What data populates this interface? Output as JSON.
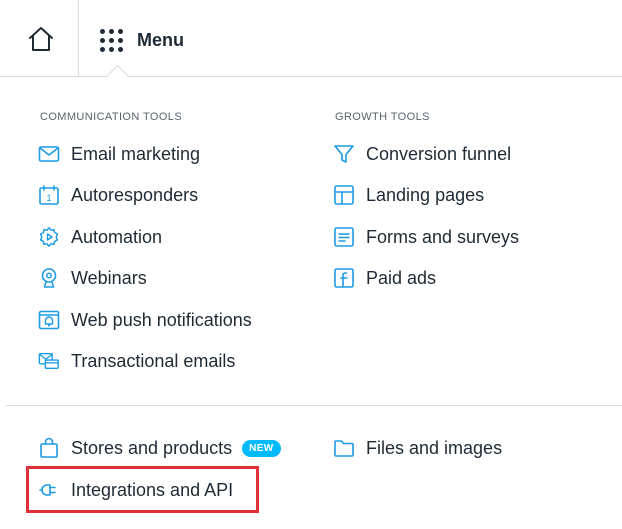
{
  "header": {
    "menu_label": "Menu"
  },
  "communication_tools": {
    "title": "COMMUNICATION TOOLS",
    "items": [
      {
        "label": "Email marketing",
        "icon": "envelope-icon"
      },
      {
        "label": "Autoresponders",
        "icon": "calendar-icon"
      },
      {
        "label": "Automation",
        "icon": "automation-gear-icon"
      },
      {
        "label": "Webinars",
        "icon": "webcam-icon"
      },
      {
        "label": "Web push notifications",
        "icon": "bell-window-icon"
      },
      {
        "label": "Transactional emails",
        "icon": "transactional-email-icon"
      }
    ]
  },
  "growth_tools": {
    "title": "GROWTH TOOLS",
    "items": [
      {
        "label": "Conversion funnel",
        "icon": "funnel-icon"
      },
      {
        "label": "Landing pages",
        "icon": "layout-icon"
      },
      {
        "label": "Forms and surveys",
        "icon": "form-icon"
      },
      {
        "label": "Paid ads",
        "icon": "facebook-ad-icon"
      }
    ]
  },
  "bottom": {
    "stores": {
      "label": "Stores and products",
      "badge": "NEW",
      "icon": "shopping-bag-icon"
    },
    "files": {
      "label": "Files and images",
      "icon": "folder-icon"
    },
    "integrations": {
      "label": "Integrations and API",
      "icon": "plug-icon"
    }
  },
  "colors": {
    "icon_blue": "#1e9be6",
    "text": "#1f2a35",
    "badge": "#00baff",
    "highlight": "#e0303a",
    "divider": "#d9dde1"
  }
}
